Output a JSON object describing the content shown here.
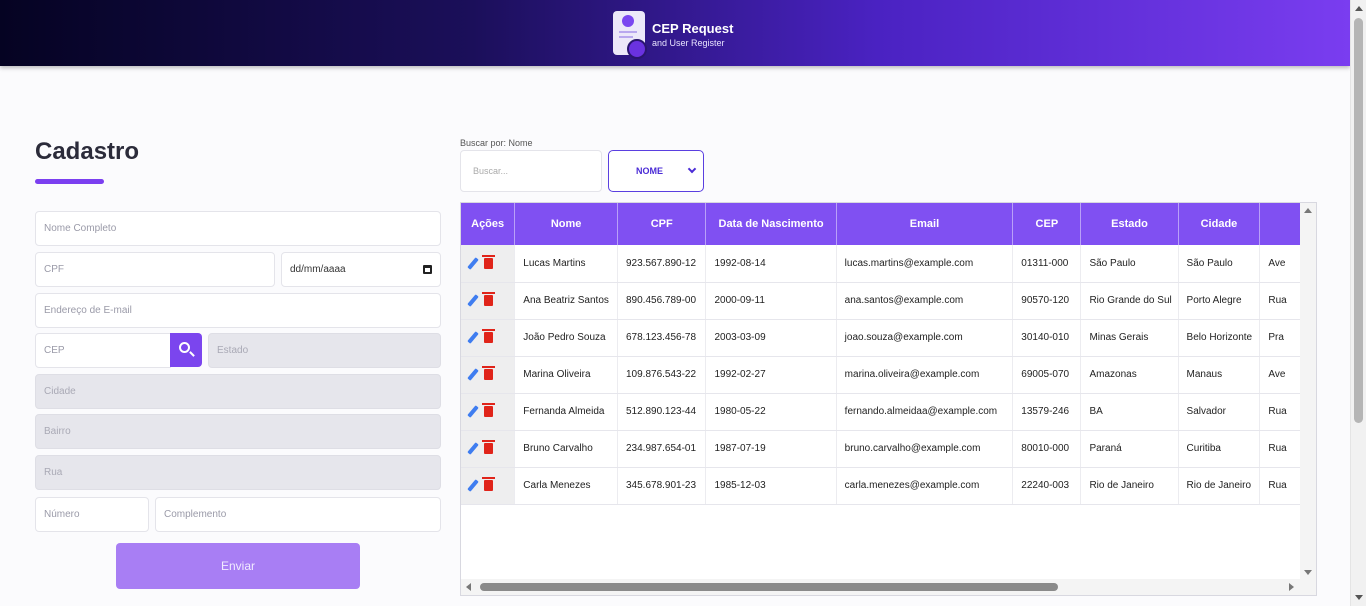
{
  "header": {
    "title": "CEP Request",
    "subtitle": "and User Register"
  },
  "form": {
    "title": "Cadastro",
    "nome_placeholder": "Nome Completo",
    "cpf_placeholder": "CPF",
    "date_placeholder": "dd/mm/aaaa",
    "email_placeholder": "Endereço de E-mail",
    "cep_placeholder": "CEP",
    "estado_placeholder": "Estado",
    "cidade_placeholder": "Cidade",
    "bairro_placeholder": "Bairro",
    "rua_placeholder": "Rua",
    "numero_placeholder": "Número",
    "complemento_placeholder": "Complemento",
    "submit_label": "Enviar"
  },
  "search": {
    "label": "Buscar por: Nome",
    "placeholder": "Buscar...",
    "select_value": "NOME"
  },
  "table": {
    "columns": [
      "Ações",
      "Nome",
      "CPF",
      "Data de Nascimento",
      "Email",
      "CEP",
      "Estado",
      "Cidade",
      ""
    ],
    "rows": [
      {
        "nome": "Lucas Martins",
        "cpf": "923.567.890-12",
        "nascimento": "1992-08-14",
        "email": "lucas.martins@example.com",
        "cep": "01311-000",
        "estado": "São Paulo",
        "cidade": "São Paulo",
        "rua": "Ave"
      },
      {
        "nome": "Ana Beatriz Santos",
        "cpf": "890.456.789-00",
        "nascimento": "2000-09-11",
        "email": "ana.santos@example.com",
        "cep": "90570-120",
        "estado": "Rio Grande do Sul",
        "cidade": "Porto Alegre",
        "rua": "Rua"
      },
      {
        "nome": "João Pedro Souza",
        "cpf": "678.123.456-78",
        "nascimento": "2003-03-09",
        "email": "joao.souza@example.com",
        "cep": "30140-010",
        "estado": "Minas Gerais",
        "cidade": "Belo Horizonte",
        "rua": "Pra"
      },
      {
        "nome": "Marina Oliveira",
        "cpf": "109.876.543-22",
        "nascimento": "1992-02-27",
        "email": "marina.oliveira@example.com",
        "cep": "69005-070",
        "estado": "Amazonas",
        "cidade": "Manaus",
        "rua": "Ave"
      },
      {
        "nome": "Fernanda Almeida",
        "cpf": "512.890.123-44",
        "nascimento": "1980-05-22",
        "email": "fernando.almeidaa@example.com",
        "cep": "13579-246",
        "estado": "BA",
        "cidade": "Salvador",
        "rua": "Rua"
      },
      {
        "nome": "Bruno Carvalho",
        "cpf": "234.987.654-01",
        "nascimento": "1987-07-19",
        "email": "bruno.carvalho@example.com",
        "cep": "80010-000",
        "estado": "Paraná",
        "cidade": "Curitiba",
        "rua": "Rua"
      },
      {
        "nome": "Carla Menezes",
        "cpf": "345.678.901-23",
        "nascimento": "1985-12-03",
        "email": "carla.menezes@example.com",
        "cep": "22240-003",
        "estado": "Rio de Janeiro",
        "cidade": "Rio de Janeiro",
        "rua": "Rua"
      }
    ]
  },
  "colors": {
    "accent": "#7b3ff0",
    "table_header": "#8050f2",
    "edit_icon": "#3f7df0",
    "delete_icon": "#e0241a"
  }
}
